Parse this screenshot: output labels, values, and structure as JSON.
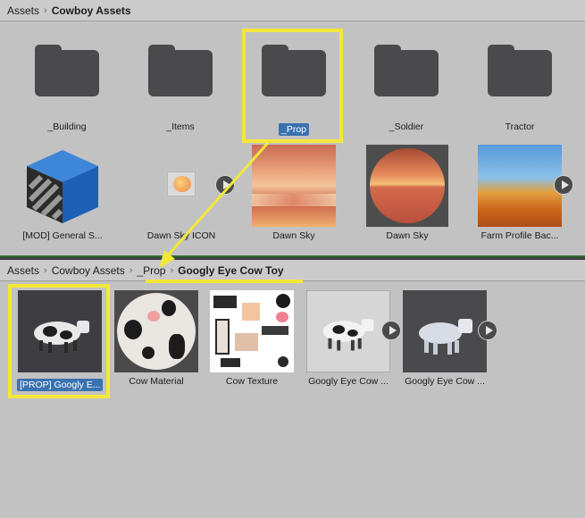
{
  "top_pane": {
    "breadcrumb": {
      "root": "Assets",
      "current": "Cowboy Assets"
    },
    "folders": [
      {
        "label": "_Building"
      },
      {
        "label": "_Items"
      },
      {
        "label": "_Prop",
        "selected": true
      },
      {
        "label": "_Soldier"
      },
      {
        "label": "Tractor"
      }
    ],
    "assets": [
      {
        "label": "[MOD] General S...",
        "icon": "cube-prefab-icon"
      },
      {
        "label": "Dawn Sky ICON",
        "icon": "sky-icon"
      },
      {
        "label": "Dawn Sky",
        "icon": "sky-texture"
      },
      {
        "label": "Dawn Sky",
        "icon": "sky-sphere-material"
      },
      {
        "label": "Farm Profile Bac...",
        "icon": "farm-profile"
      }
    ]
  },
  "bottom_pane": {
    "breadcrumb": {
      "root": "Assets",
      "parent": "Cowboy Assets",
      "folder": "_Prop",
      "current": "Googly Eye Cow Toy"
    },
    "assets": [
      {
        "label": "[PROP] Googly E...",
        "selected": true,
        "icon": "cow-prefab"
      },
      {
        "label": "Cow Material",
        "icon": "material-sphere"
      },
      {
        "label": "Cow Texture",
        "icon": "texture"
      },
      {
        "label": "Googly Eye Cow ...",
        "icon": "cow-model"
      },
      {
        "label": "Googly Eye Cow ...",
        "icon": "cow-model-white"
      }
    ]
  },
  "colors": {
    "highlight": "#f3e83a",
    "selection": "#3a72b0",
    "folder": "#4a4a4c"
  }
}
